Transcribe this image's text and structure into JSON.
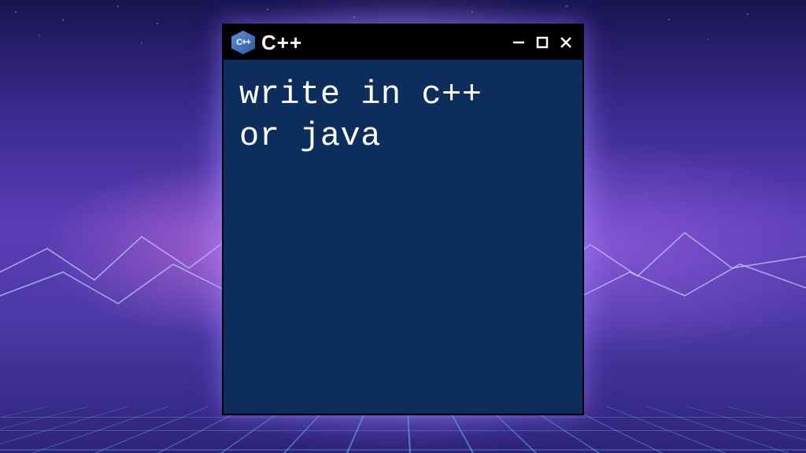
{
  "window": {
    "title": "C++",
    "icon_label": "C++",
    "content": "write in c++\nor java"
  },
  "colors": {
    "window_bg": "#0d2e5c",
    "titlebar_bg": "#000000",
    "text": "#ffffff"
  }
}
